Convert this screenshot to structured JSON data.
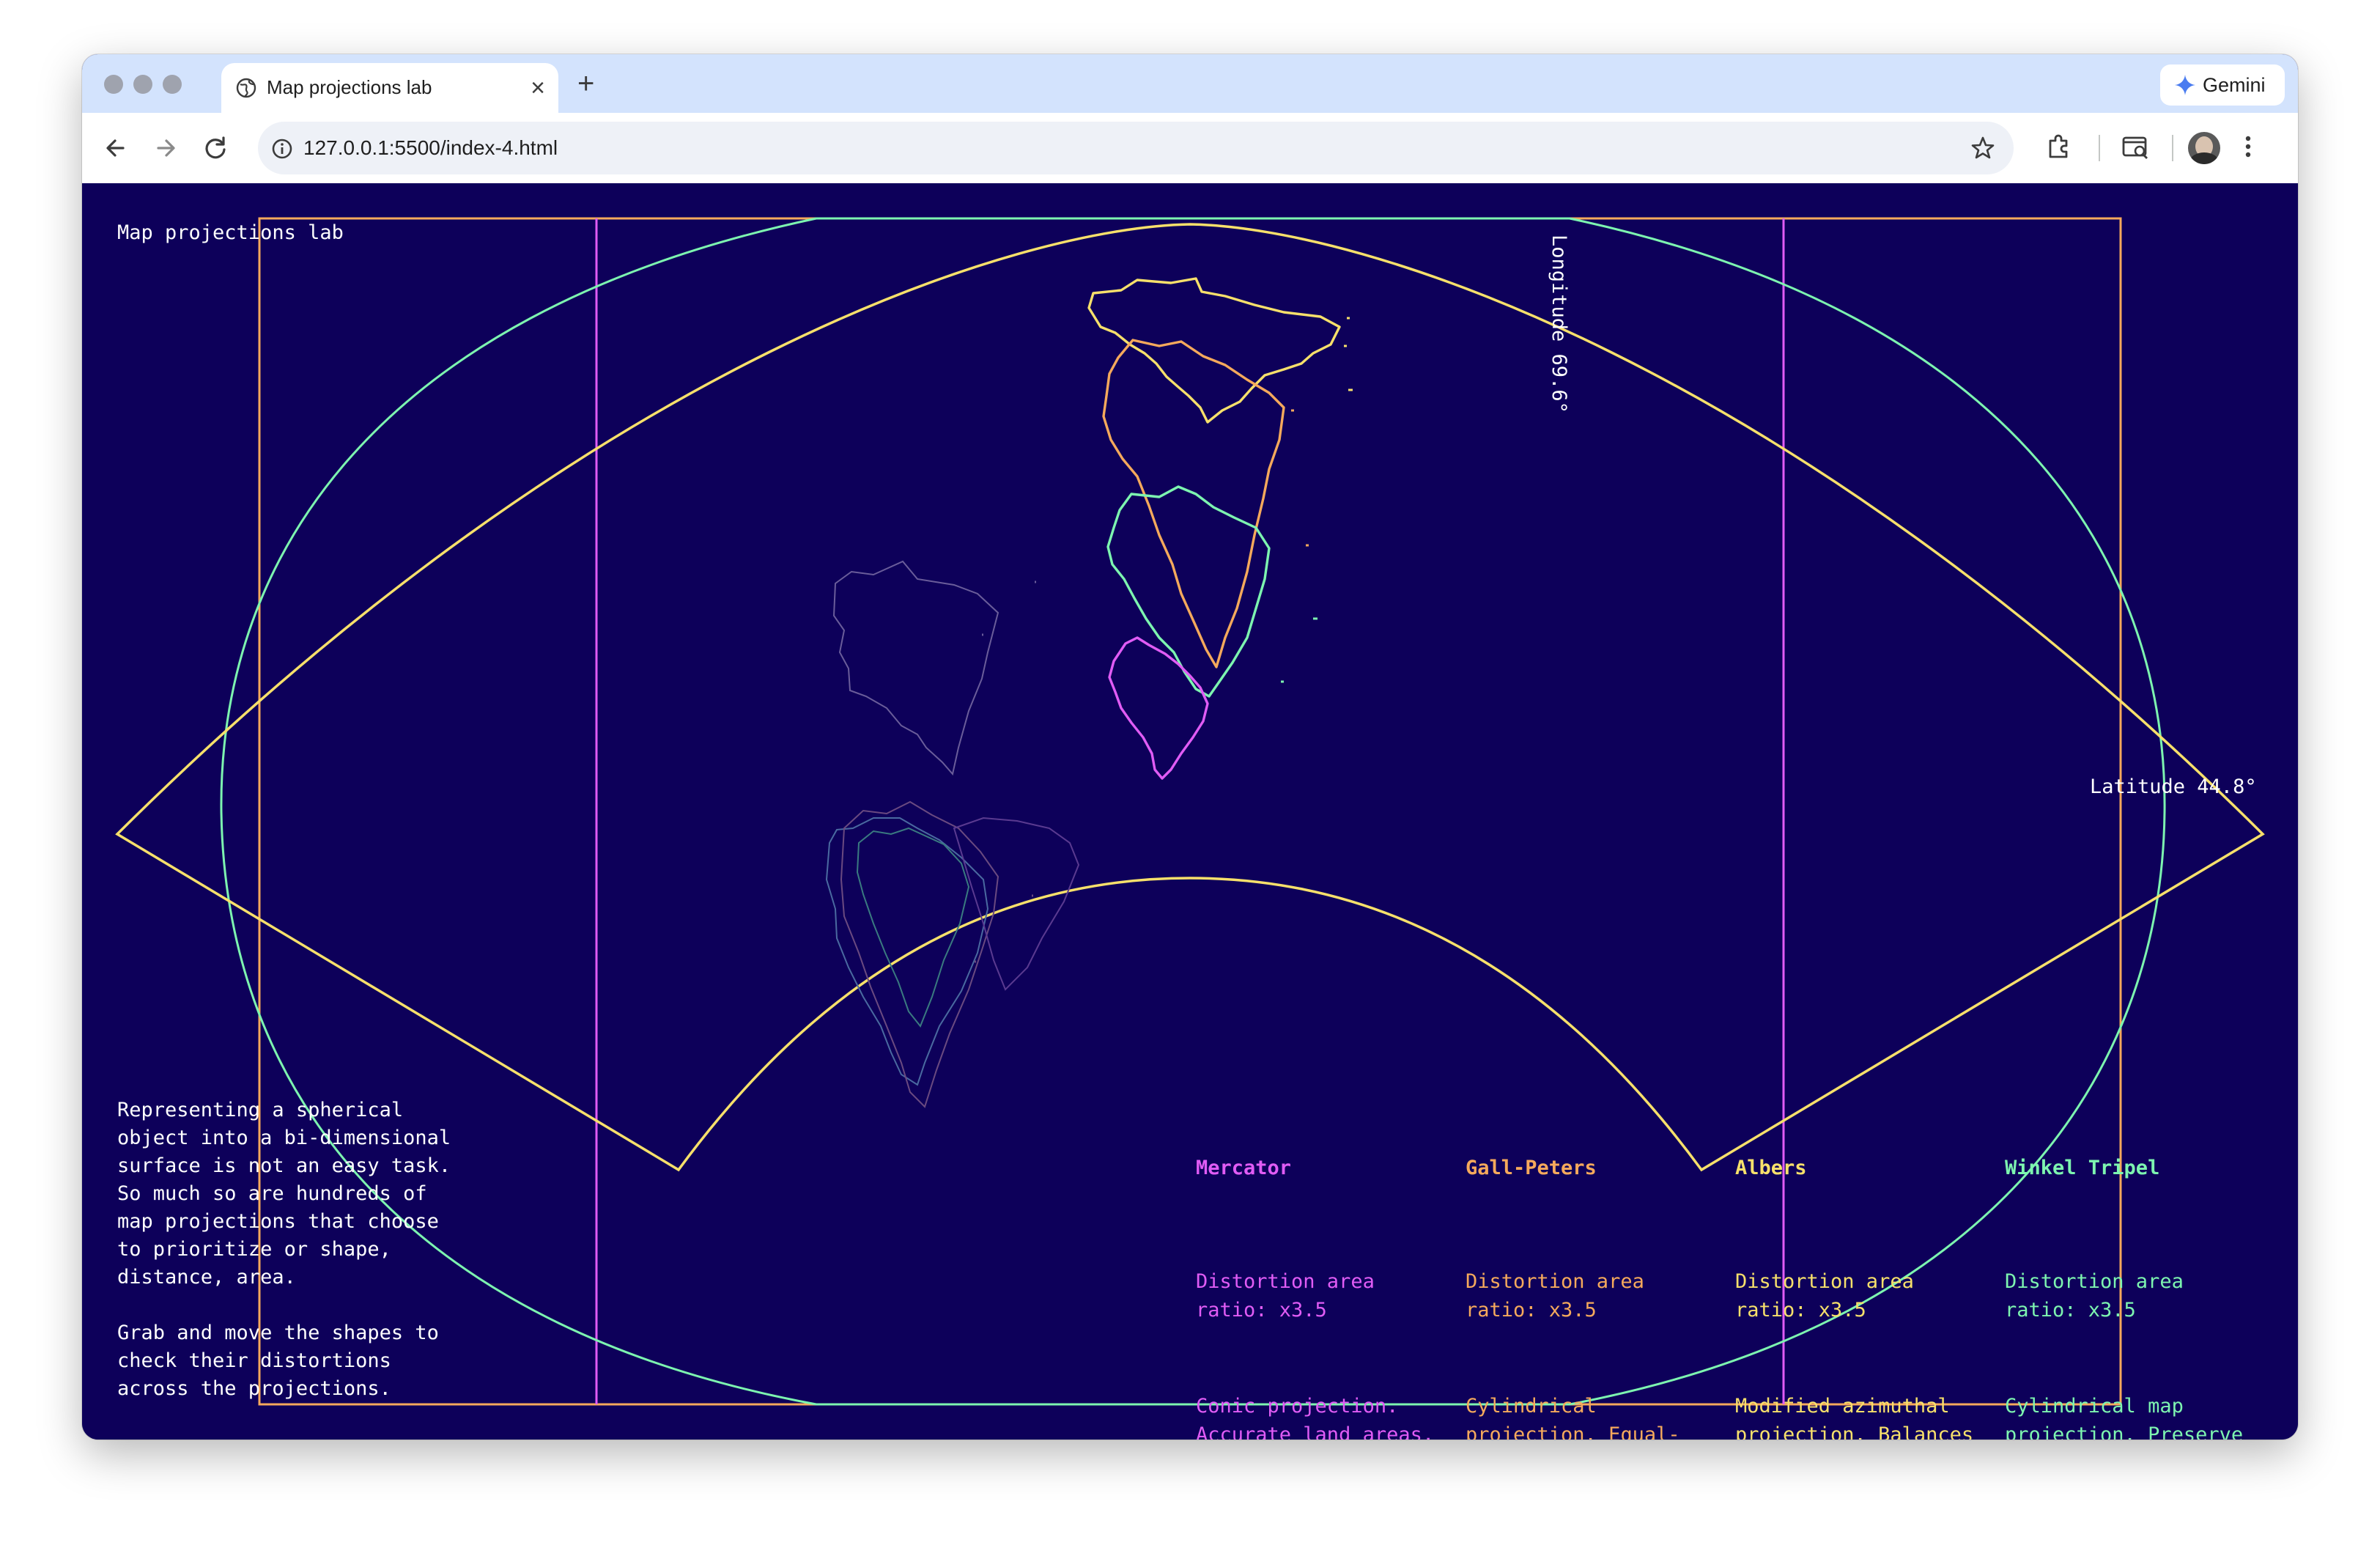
{
  "browser": {
    "tab_title": "Map projections lab",
    "url": "127.0.0.1:5500/index-4.html",
    "gemini_label": "Gemini",
    "new_tab_symbol": "+",
    "close_symbol": "×"
  },
  "page": {
    "title": "Map projections lab",
    "longitude_label": "Longitude 69.6°",
    "latitude_label": "Latitude 44.8°",
    "intro": "Representing a spherical\nobject into a bi-dimensional\nsurface is not an easy task.\nSo much so are hundreds of\nmap projections that choose\nto prioritize or shape,\ndistance, area.\n\nGrab and move the shapes to\ncheck their distortions\nacross the projections."
  },
  "projections": [
    {
      "name": "Mercator",
      "color": "#e05cf5",
      "ratio": "Distortion area\nratio: x3.5",
      "description": "Conic projection.\nAccurate land areas,\ndistorts shapes and\ndistances."
    },
    {
      "name": "Gall-Peters",
      "color": "#f5a95c",
      "ratio": "Distortion area\nratio: x3.5",
      "description": "Cylindrical\nprojection. Equal-\narea map projection,\nnot accurate shapes."
    },
    {
      "name": "Albers",
      "color": "#f7e06b",
      "ratio": "Distortion area\nratio: x3.5",
      "description": "Modified azimuthal\nprojection. Balances\ndistortions of area,\ndirection, and\ndistance."
    },
    {
      "name": "Winkel Tripel",
      "color": "#7df5b0",
      "ratio": "Distortion area\nratio: x3.5",
      "description": "Cylindrical map\nprojection. Preserve\nshapes,\nsignificantly\ndistortion of sizes"
    }
  ],
  "icons": {
    "favicon": "globe-icon",
    "back": "arrow-left-icon",
    "forward": "arrow-right-icon",
    "reload": "reload-icon",
    "site_info": "info-icon",
    "bookmark": "star-icon",
    "extensions": "puzzle-icon",
    "tab_search": "tab-search-icon",
    "profile": "avatar",
    "menu": "kebab-menu-icon"
  }
}
